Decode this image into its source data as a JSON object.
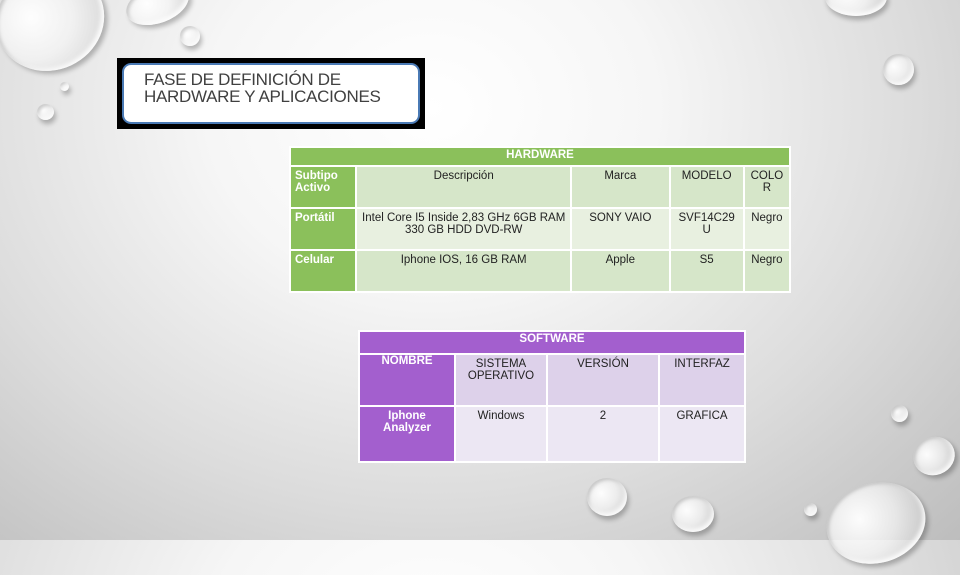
{
  "title": {
    "line1": "FASE DE DEFINICIÓN  DE",
    "line2": "HARDWARE  Y APLICACIONES"
  },
  "hardware": {
    "caption": "HARDWARE",
    "columns": [
      "Subtipo Activo",
      "Descripción",
      "Marca",
      "MODELO",
      "COLOR"
    ],
    "rows": [
      {
        "subtipo": "Portátil",
        "descripcion": "Intel Core I5 Inside 2,83 GHz 6GB RAM 330 GB HDD DVD-RW",
        "marca": "SONY VAIO",
        "modelo": "SVF14C29U",
        "color": "Negro"
      },
      {
        "subtipo": "Celular",
        "descripcion": "Iphone IOS, 16 GB RAM",
        "marca": "Apple",
        "modelo": "S5",
        "color": "Negro"
      }
    ],
    "colors": {
      "header": "#8bc05b",
      "header_cell": "#d6e6c9",
      "cell": "#e8f0e0"
    }
  },
  "software": {
    "caption": "SOFTWARE",
    "columns": [
      "NOMBRE",
      "SISTEMA OPERATIVO",
      "VERSIÓN",
      "INTERFAZ"
    ],
    "rows": [
      {
        "nombre": "Iphone Analyzer",
        "sistema": "Windows",
        "version": "2",
        "interfaz": "GRAFICA"
      }
    ],
    "colors": {
      "header": "#a35fce",
      "header_cell": "#ddd1ea",
      "cell": "#ece7f3"
    }
  }
}
